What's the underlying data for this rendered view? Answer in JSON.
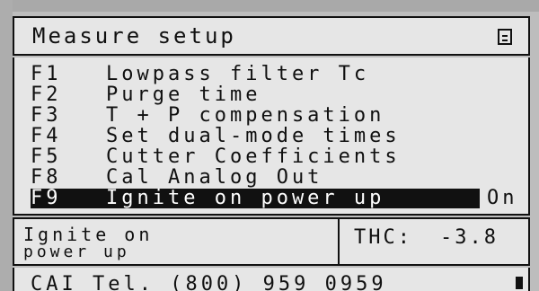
{
  "header": {
    "title": "Measure setup",
    "menu_icon": "menu-icon"
  },
  "menu": {
    "items": [
      {
        "key": "F1",
        "label": "Lowpass filter Tc"
      },
      {
        "key": "F2",
        "label": "Purge time"
      },
      {
        "key": "F3",
        "label": "T + P compensation"
      },
      {
        "key": "F4",
        "label": "Set dual-mode times"
      },
      {
        "key": "F5",
        "label": "Cutter Coefficients"
      },
      {
        "key": "F8",
        "label": "Cal Analog Out"
      },
      {
        "key": "F9",
        "label": "Ignite on power up",
        "value": "On"
      }
    ]
  },
  "status": {
    "left_title": "Ignite on",
    "left_subtitle": "power up",
    "right_label": "THC:",
    "right_value": "-3.8"
  },
  "footer": {
    "text": "CAI Tel. (800) 959 0959"
  }
}
